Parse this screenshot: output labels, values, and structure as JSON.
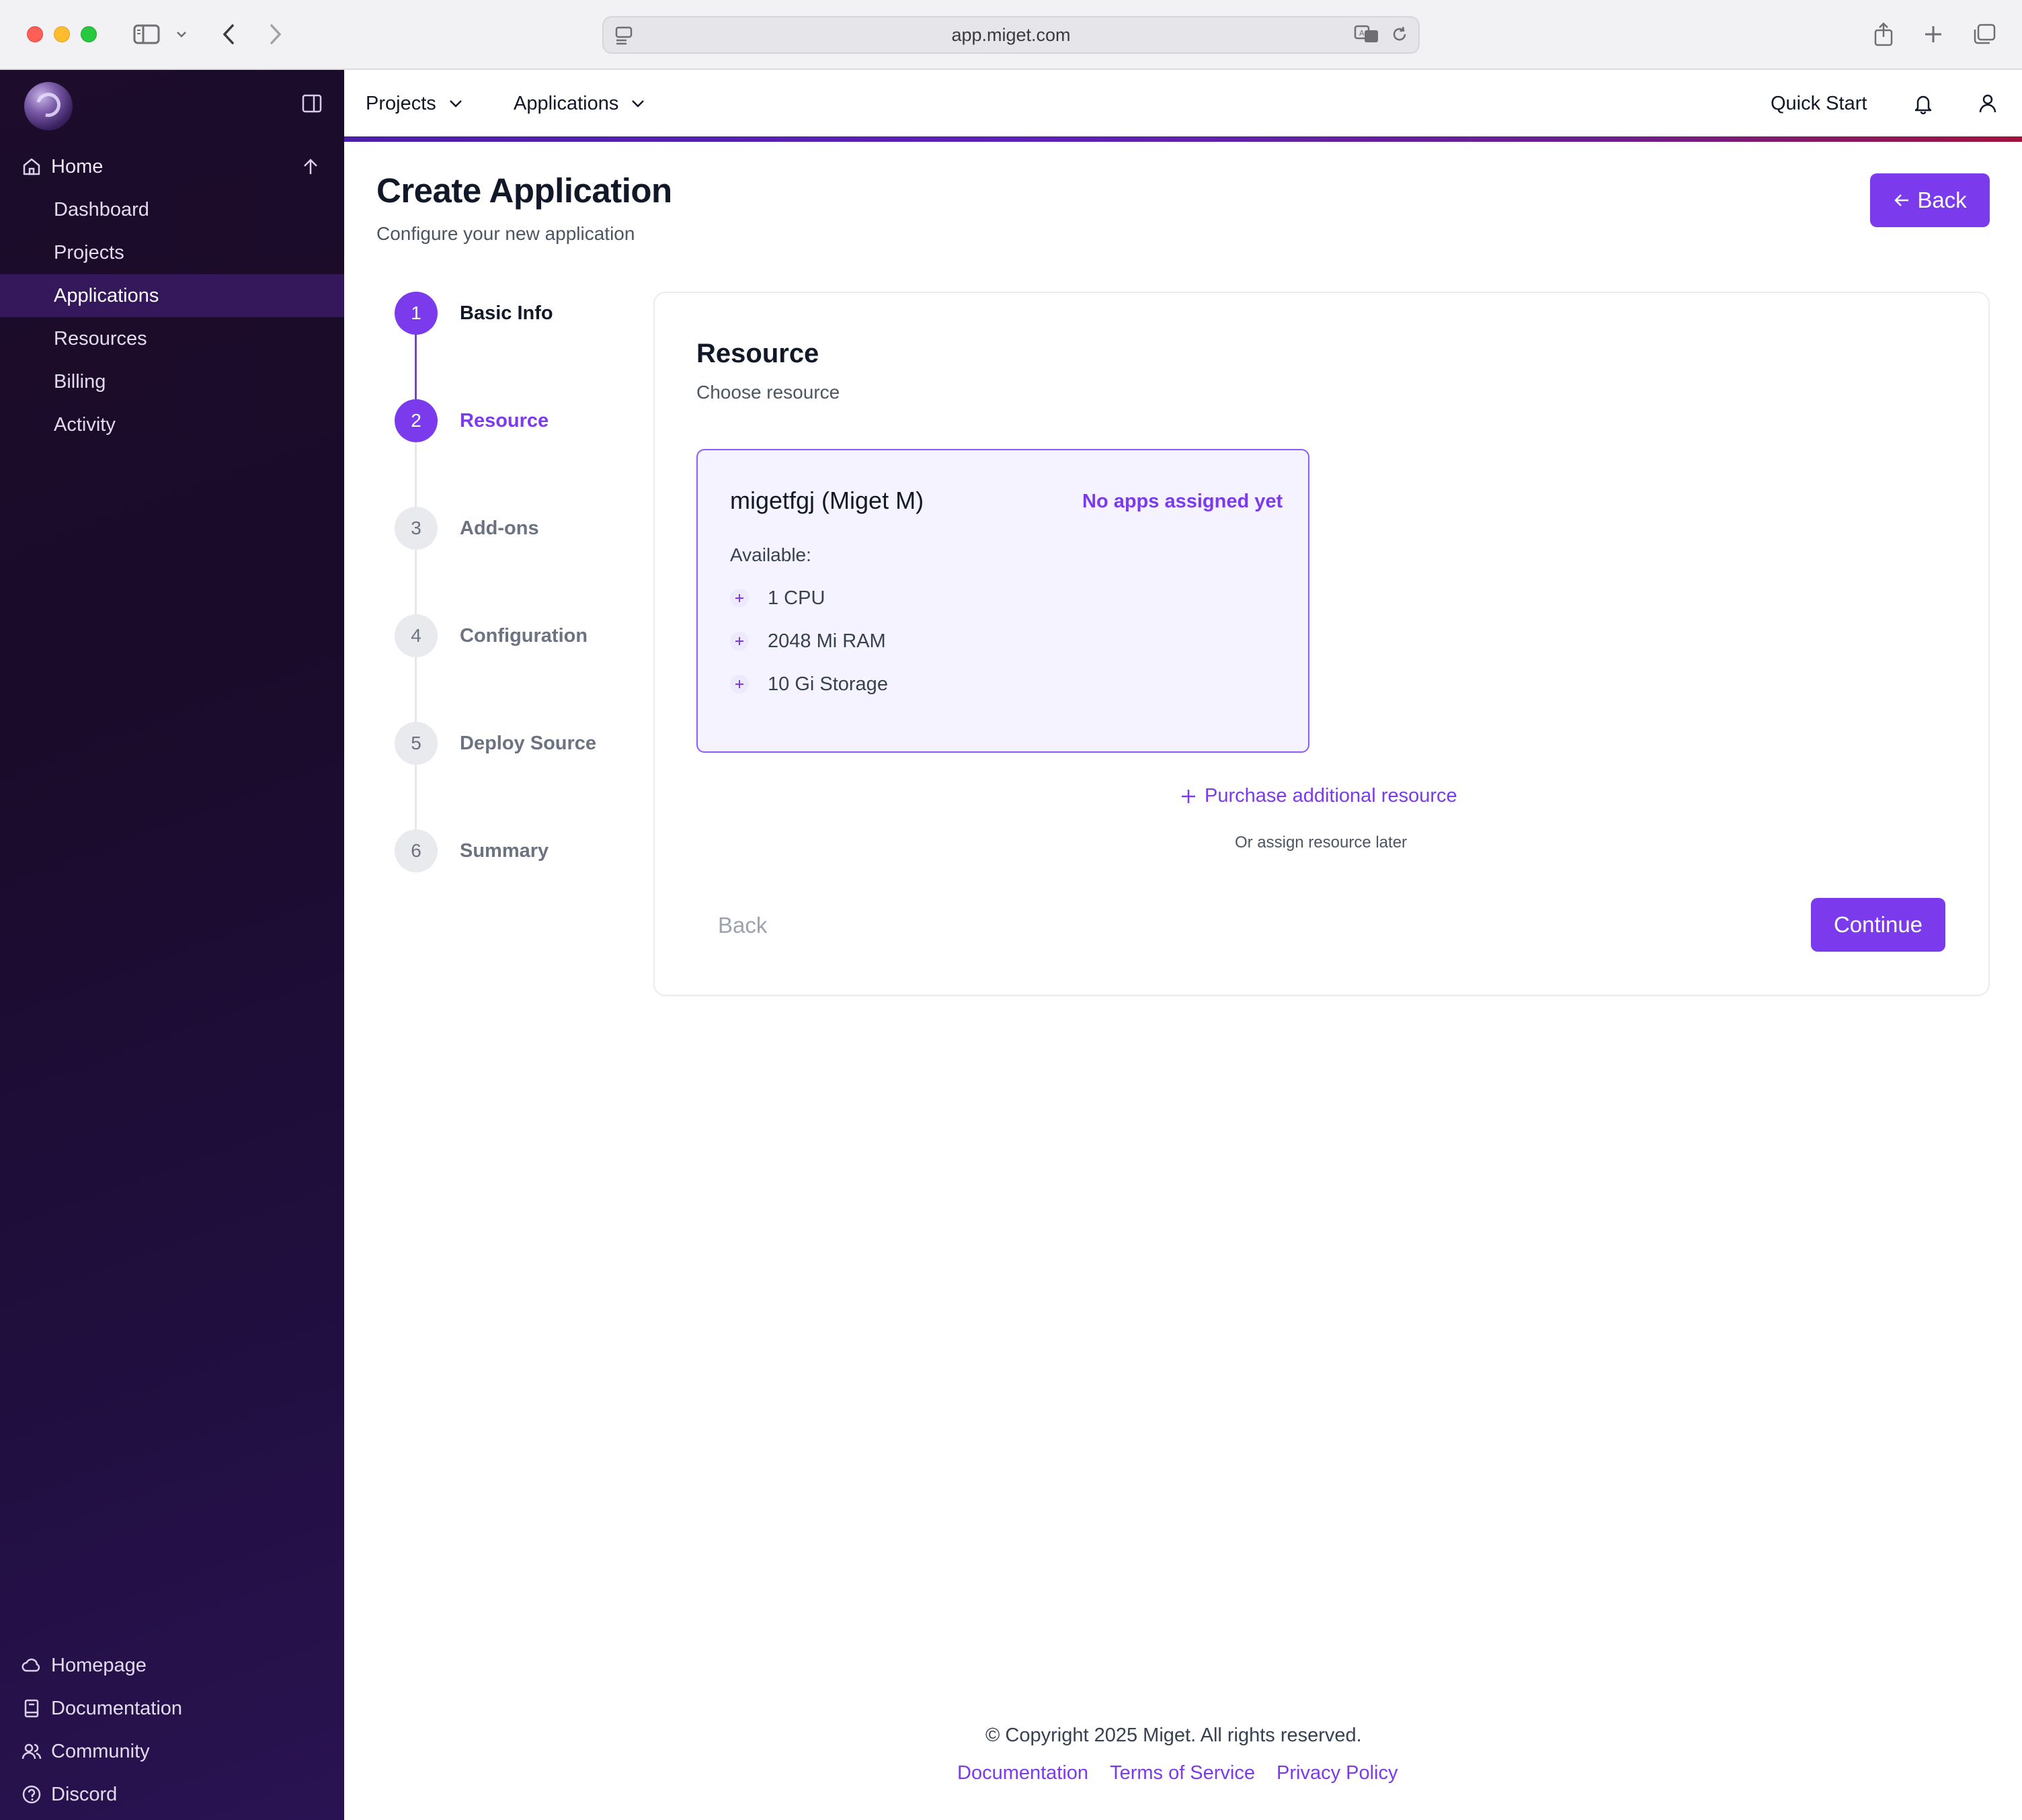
{
  "browser": {
    "url": "app.miget.com"
  },
  "sidebar": {
    "home_label": "Home",
    "items": [
      {
        "label": "Dashboard",
        "active": false
      },
      {
        "label": "Projects",
        "active": false
      },
      {
        "label": "Applications",
        "active": true
      },
      {
        "label": "Resources",
        "active": false
      },
      {
        "label": "Billing",
        "active": false
      },
      {
        "label": "Activity",
        "active": false
      }
    ],
    "footer_items": [
      {
        "label": "Homepage",
        "icon": "cloud-icon"
      },
      {
        "label": "Documentation",
        "icon": "book-icon"
      },
      {
        "label": "Community",
        "icon": "users-icon"
      },
      {
        "label": "Discord",
        "icon": "help-circle-icon"
      }
    ]
  },
  "topnav": {
    "projects_label": "Projects",
    "applications_label": "Applications",
    "quick_start_label": "Quick Start"
  },
  "page": {
    "title": "Create Application",
    "subtitle": "Configure your new application",
    "back_button_label": "Back"
  },
  "stepper": {
    "steps": [
      {
        "number": "1",
        "label": "Basic Info",
        "state": "done"
      },
      {
        "number": "2",
        "label": "Resource",
        "state": "current"
      },
      {
        "number": "3",
        "label": "Add-ons",
        "state": "pending"
      },
      {
        "number": "4",
        "label": "Configuration",
        "state": "pending"
      },
      {
        "number": "5",
        "label": "Deploy Source",
        "state": "pending"
      },
      {
        "number": "6",
        "label": "Summary",
        "state": "pending"
      }
    ]
  },
  "resource_section": {
    "title": "Resource",
    "subtitle": "Choose resource",
    "resource": {
      "name": "migetfgj (Miget M)",
      "badge": "No apps assigned yet",
      "available_label": "Available:",
      "specs": [
        "1 CPU",
        "2048 Mi RAM",
        "10 Gi Storage"
      ]
    },
    "purchase_label": "Purchase additional resource",
    "assign_later_label": "Or assign resource later",
    "back_label": "Back",
    "continue_label": "Continue"
  },
  "footer": {
    "copyright": "© Copyright 2025 Miget. All rights reserved.",
    "links": [
      "Documentation",
      "Terms of Service",
      "Privacy Policy"
    ]
  },
  "colors": {
    "accent": "#7c3aed",
    "sidebar_bg": "#1d0c2b",
    "sidebar_active": "#34185b"
  }
}
